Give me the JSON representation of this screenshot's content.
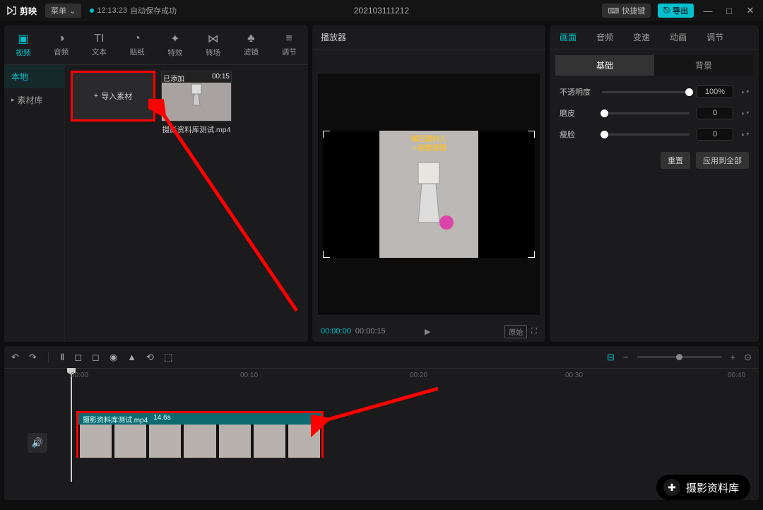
{
  "titlebar": {
    "app": "剪映",
    "menu": "菜单",
    "autosave_time": "12:13:23",
    "autosave_msg": "自动保存成功",
    "project": "202103111212",
    "shortcut": "快捷键",
    "export": "导出"
  },
  "media_tabs": [
    {
      "icon": "▣",
      "label": "视频"
    },
    {
      "icon": "◑",
      "label": "音频"
    },
    {
      "icon": "TI",
      "label": "文本"
    },
    {
      "icon": "◔",
      "label": "贴纸"
    },
    {
      "icon": "✦",
      "label": "特效"
    },
    {
      "icon": "⋈",
      "label": "转场"
    },
    {
      "icon": "♣",
      "label": "滤镜"
    },
    {
      "icon": "≡",
      "label": "调节"
    }
  ],
  "side": {
    "local": "本地",
    "library": "素材库"
  },
  "import_label": "导入素材",
  "clip": {
    "badge": "已添加",
    "duration": "00:15",
    "name": "摄影资料库测试.mp4"
  },
  "preview": {
    "title": "播放器",
    "caption1": "嘴巴甜的人",
    "caption2": "一般都很假",
    "time_cur": "00:00:00",
    "time_total": "00:00:15",
    "ratio": "原始"
  },
  "inspector": {
    "tabs": [
      "画面",
      "音频",
      "变速",
      "动画",
      "调节"
    ],
    "sub": [
      "基础",
      "背景"
    ],
    "opacity_label": "不透明度",
    "opacity_val": "100%",
    "smooth_label": "磨皮",
    "smooth_val": "0",
    "face_label": "瘦脸",
    "face_val": "0",
    "reset": "重置",
    "apply": "应用到全部"
  },
  "ruler": [
    "00:00",
    "00:10",
    "00:20",
    "00:30",
    "00:40"
  ],
  "strip": {
    "name": "摄影资料库测试.mp4",
    "dur": "14.6s"
  },
  "watermark": "摄影资料库"
}
